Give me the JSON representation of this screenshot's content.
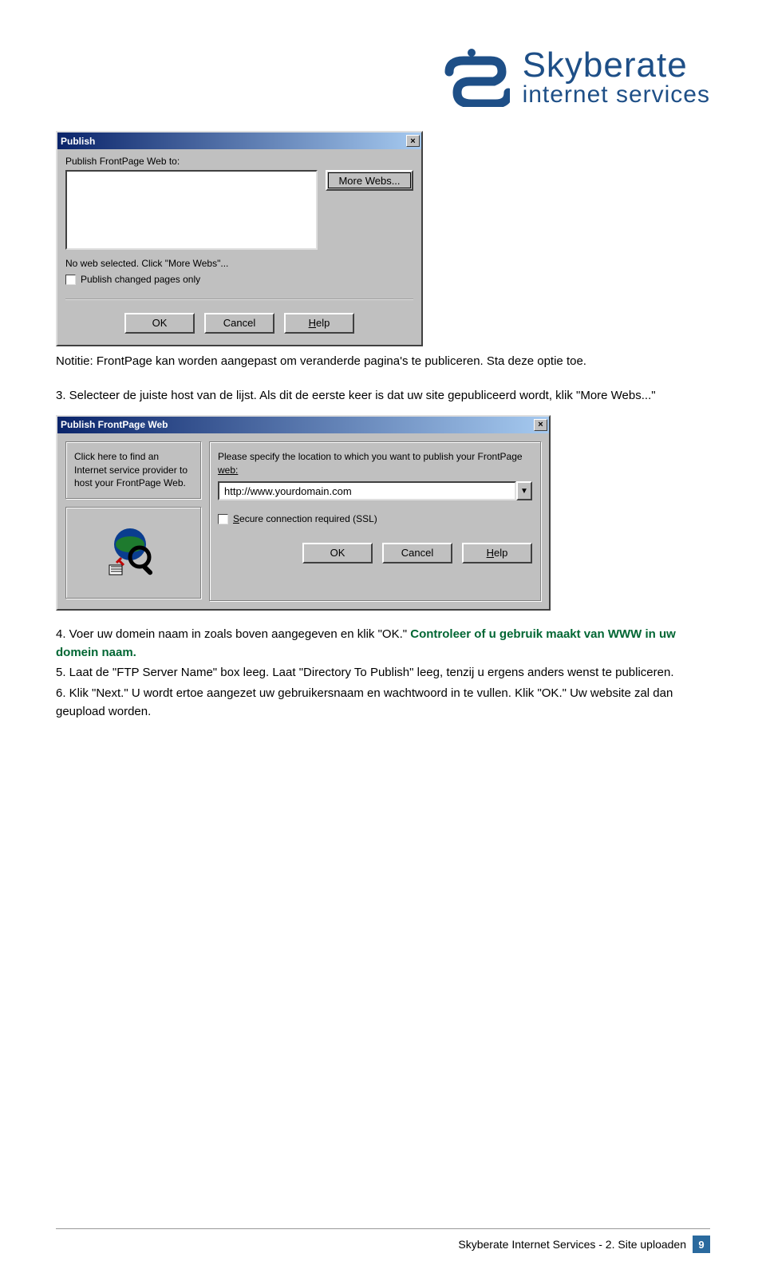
{
  "logo": {
    "top": "Skyberate",
    "bottom": "internet services"
  },
  "dlg1": {
    "title": "Publish",
    "label": "Publish FrontPage Web to:",
    "moreWebs": "More Webs...",
    "status": "No web selected. Click \"More Webs\"...",
    "checkbox": "Publish changed pages only",
    "ok": "OK",
    "cancel": "Cancel",
    "help": "Help"
  },
  "note": "Notitie: FrontPage kan worden aangepast om veranderde pagina's te publiceren. Sta deze optie toe.",
  "step3": "3. Selecteer de juiste host van de lijst. Als dit de eerste keer is dat uw site gepubliceerd wordt, klik \"More Webs...\"",
  "dlg2": {
    "title": "Publish FrontPage Web",
    "leftText": "Click here to find an Internet service provider to host your FrontPage Web.",
    "instr1": "Please specify the location to which you want to publish your FrontPage ",
    "webUnderline": "web:",
    "url": "http://www.yourdomain.com",
    "sslUnderline": "Secure connection required (SSL)",
    "ok": "OK",
    "cancel": "Cancel",
    "help": "Help"
  },
  "steps": {
    "s4a": "4. Voer uw domein naam in zoals boven aangegeven en klik \"OK.\" ",
    "s4b": "Controleer of u gebruik maakt van WWW in uw domein naam.",
    "s5": "5. Laat de \"FTP Server Name\" box leeg. Laat \"Directory To Publish\" leeg, tenzij u ergens anders wenst te publiceren.",
    "s6": "6. Klik \"Next.\" U wordt ertoe aangezet uw gebruikersnaam en wachtwoord in te vullen. Klik \"OK.\" Uw website zal dan geupload worden."
  },
  "footer": {
    "text": "Skyberate Internet Services  - 2. Site uploaden",
    "page": "9"
  }
}
